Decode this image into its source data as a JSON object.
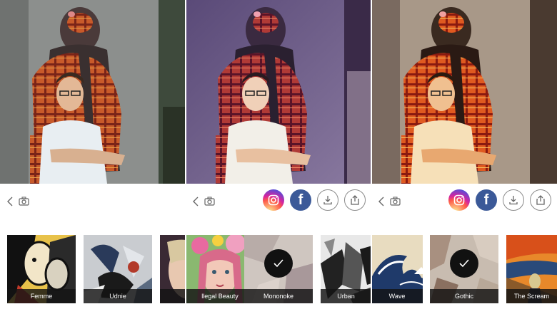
{
  "panels": [
    {
      "id": "original",
      "show_share": false,
      "styles": [
        {
          "label": "Femme",
          "selected": false
        },
        {
          "label": "Udnie",
          "selected": false
        },
        {
          "label": "",
          "selected": false
        }
      ]
    },
    {
      "id": "mononoke",
      "show_share": true,
      "styles": [
        {
          "label": "llegal Beauty",
          "selected": false
        },
        {
          "label": "Mononoke",
          "selected": true
        },
        {
          "label": "Urban",
          "selected": false
        }
      ]
    },
    {
      "id": "gothic",
      "show_share": true,
      "styles": [
        {
          "label": "Wave",
          "selected": false
        },
        {
          "label": "Gothic",
          "selected": true
        },
        {
          "label": "The Scream",
          "selected": false
        }
      ]
    }
  ],
  "toolbar": {
    "back_icon": "chevron-left-icon",
    "camera_icon": "camera-icon",
    "instagram_icon": "instagram-icon",
    "facebook_glyph": "f",
    "download_icon": "download-icon",
    "share_icon": "share-icon"
  },
  "colors": {
    "facebook": "#3b5998",
    "caption_bg": "#141414",
    "check_bg": "#111111"
  }
}
